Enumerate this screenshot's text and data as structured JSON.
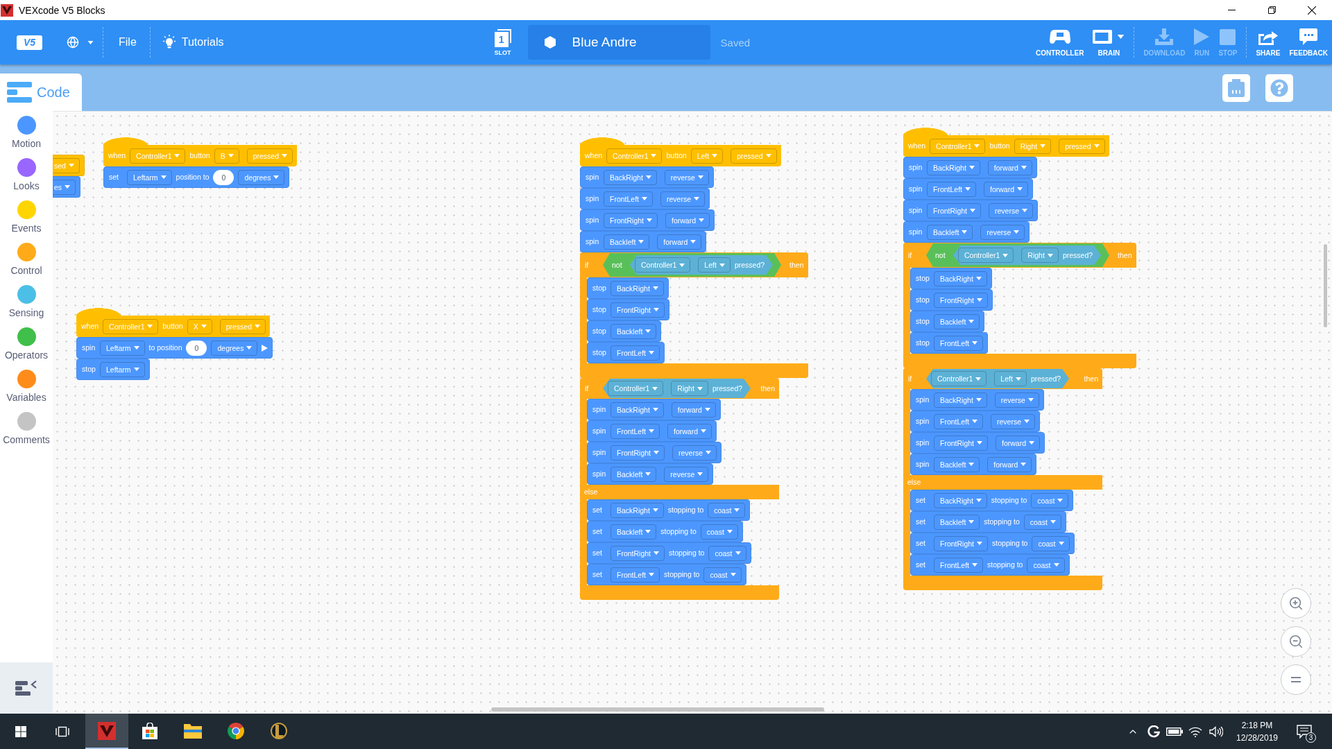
{
  "window": {
    "title": "VEXcode V5 Blocks"
  },
  "toolbar": {
    "logo": "V5",
    "file_menu": "File",
    "tutorials": "Tutorials",
    "slot": {
      "number": "1",
      "label": "SLOT"
    },
    "project_name": "Blue Andre",
    "save_status": "Saved",
    "actions": [
      {
        "kind": "controller",
        "label": "CONTROLLER",
        "disabled": false
      },
      {
        "kind": "brain",
        "label": "BRAIN",
        "disabled": false
      },
      {
        "kind": "download",
        "label": "DOWNLOAD",
        "disabled": true
      },
      {
        "kind": "run",
        "label": "RUN",
        "disabled": true
      },
      {
        "kind": "stop",
        "label": "STOP",
        "disabled": true
      },
      {
        "kind": "share",
        "label": "SHARE",
        "disabled": false
      },
      {
        "kind": "feedback",
        "label": "FEEDBACK",
        "disabled": false
      }
    ]
  },
  "tabs": [
    {
      "label": "Code",
      "selected": true
    }
  ],
  "categories": [
    {
      "label": "Motion",
      "color": "#4c97ff"
    },
    {
      "label": "Looks",
      "color": "#9966ff"
    },
    {
      "label": "Events",
      "color": "#ffd500"
    },
    {
      "label": "Control",
      "color": "#ffab19"
    },
    {
      "label": "Sensing",
      "color": "#4cbfe6"
    },
    {
      "label": "Operators",
      "color": "#40bf4a"
    },
    {
      "label": "Variables",
      "color": "#ff8c1a"
    },
    {
      "label": "Comments",
      "color": "#c4c4c4"
    }
  ],
  "workspace": {
    "scripts": [
      {
        "blocks": [
          {
            "kind": "stack",
            "color": "#ffbf00",
            "parts": [
              {
                "kind": "dropdown",
                "text": "sed"
              }
            ]
          },
          {
            "kind": "stack",
            "color": "#4c97ff",
            "parts": [
              {
                "kind": "dropdown",
                "text": "es"
              }
            ]
          }
        ]
      },
      {
        "blocks": [
          {
            "kind": "hat",
            "color": "#ffbf00",
            "parts": [
              {
                "kind": "label",
                "text": "when"
              },
              {
                "kind": "dropdown",
                "text": "Controller1"
              },
              {
                "kind": "label",
                "text": "button"
              },
              {
                "kind": "dropdown",
                "text": "B"
              },
              {
                "kind": "dropdown",
                "text": "pressed"
              }
            ]
          },
          {
            "kind": "stack",
            "color": "#4c97ff",
            "parts": [
              {
                "kind": "label",
                "text": "set"
              },
              {
                "kind": "dropdown",
                "text": "Leftarm"
              },
              {
                "kind": "label",
                "text": "position to"
              },
              {
                "kind": "number",
                "text": "0"
              },
              {
                "kind": "dropdown",
                "text": "degrees"
              }
            ]
          }
        ]
      },
      {
        "blocks": [
          {
            "kind": "hat",
            "color": "#ffbf00",
            "parts": [
              {
                "kind": "label",
                "text": "when"
              },
              {
                "kind": "dropdown",
                "text": "Controller1"
              },
              {
                "kind": "label",
                "text": "button"
              },
              {
                "kind": "dropdown",
                "text": "X"
              },
              {
                "kind": "dropdown",
                "text": "pressed"
              }
            ]
          },
          {
            "kind": "stack",
            "color": "#4c97ff",
            "parts": [
              {
                "kind": "label",
                "text": "spin"
              },
              {
                "kind": "dropdown",
                "text": "Leftarm"
              },
              {
                "kind": "label",
                "text": "to position"
              },
              {
                "kind": "number",
                "text": "0"
              },
              {
                "kind": "dropdown",
                "text": "degrees"
              },
              {
                "kind": "expander"
              }
            ]
          },
          {
            "kind": "stack",
            "color": "#4c97ff",
            "parts": [
              {
                "kind": "label",
                "text": "stop"
              },
              {
                "kind": "dropdown",
                "text": "Leftarm"
              }
            ]
          }
        ]
      },
      {
        "blocks": [
          {
            "kind": "hat",
            "color": "#ffbf00",
            "parts": [
              {
                "kind": "label",
                "text": "when"
              },
              {
                "kind": "dropdown",
                "text": "Controller1"
              },
              {
                "kind": "label",
                "text": "button"
              },
              {
                "kind": "dropdown",
                "text": "Left"
              },
              {
                "kind": "dropdown",
                "text": "pressed"
              }
            ]
          },
          {
            "kind": "stack",
            "color": "#4c97ff",
            "parts": [
              {
                "kind": "label",
                "text": "spin"
              },
              {
                "kind": "dropdown",
                "text": "BackRight"
              },
              {
                "kind": "dropdown",
                "text": "reverse"
              }
            ]
          },
          {
            "kind": "stack",
            "color": "#4c97ff",
            "parts": [
              {
                "kind": "label",
                "text": "spin"
              },
              {
                "kind": "dropdown",
                "text": "FrontLeft"
              },
              {
                "kind": "dropdown",
                "text": "reverse"
              }
            ]
          },
          {
            "kind": "stack",
            "color": "#4c97ff",
            "parts": [
              {
                "kind": "label",
                "text": "spin"
              },
              {
                "kind": "dropdown",
                "text": "FrontRight"
              },
              {
                "kind": "dropdown",
                "text": "forward"
              }
            ]
          },
          {
            "kind": "stack",
            "color": "#4c97ff",
            "parts": [
              {
                "kind": "label",
                "text": "spin"
              },
              {
                "kind": "dropdown",
                "text": "Backleft"
              },
              {
                "kind": "dropdown",
                "text": "forward"
              }
            ]
          },
          {
            "kind": "if",
            "color": "#ffab19",
            "parts": [
              {
                "kind": "label",
                "text": "if"
              },
              {
                "kind": "boolean",
                "color": "#59c059",
                "parts": [
                  {
                    "kind": "label",
                    "text": "not"
                  },
                  {
                    "kind": "boolean",
                    "color": "#5cb1d6",
                    "parts": [
                      {
                        "kind": "dropdown",
                        "text": "Controller1"
                      },
                      {
                        "kind": "dropdown",
                        "text": "Left"
                      },
                      {
                        "kind": "label",
                        "text": "pressed?"
                      }
                    ]
                  }
                ]
              },
              {
                "kind": "label",
                "text": "then"
              }
            ],
            "body": [
              {
                "kind": "stack",
                "color": "#4c97ff",
                "parts": [
                  {
                    "kind": "label",
                    "text": "stop"
                  },
                  {
                    "kind": "dropdown",
                    "text": "BackRight"
                  }
                ]
              },
              {
                "kind": "stack",
                "color": "#4c97ff",
                "parts": [
                  {
                    "kind": "label",
                    "text": "stop"
                  },
                  {
                    "kind": "dropdown",
                    "text": "FrontRight"
                  }
                ]
              },
              {
                "kind": "stack",
                "color": "#4c97ff",
                "parts": [
                  {
                    "kind": "label",
                    "text": "stop"
                  },
                  {
                    "kind": "dropdown",
                    "text": "Backleft"
                  }
                ]
              },
              {
                "kind": "stack",
                "color": "#4c97ff",
                "parts": [
                  {
                    "kind": "label",
                    "text": "stop"
                  },
                  {
                    "kind": "dropdown",
                    "text": "FrontLeft"
                  }
                ]
              }
            ]
          },
          {
            "kind": "if_else",
            "color": "#ffab19",
            "parts": [
              {
                "kind": "label",
                "text": "if"
              },
              {
                "kind": "boolean",
                "color": "#5cb1d6",
                "parts": [
                  {
                    "kind": "dropdown",
                    "text": "Controller1"
                  },
                  {
                    "kind": "dropdown",
                    "text": "Right"
                  },
                  {
                    "kind": "label",
                    "text": "pressed?"
                  }
                ]
              },
              {
                "kind": "label",
                "text": "then"
              }
            ],
            "body": [
              {
                "kind": "stack",
                "color": "#4c97ff",
                "parts": [
                  {
                    "kind": "label",
                    "text": "spin"
                  },
                  {
                    "kind": "dropdown",
                    "text": "BackRight"
                  },
                  {
                    "kind": "dropdown",
                    "text": "forward"
                  }
                ]
              },
              {
                "kind": "stack",
                "color": "#4c97ff",
                "parts": [
                  {
                    "kind": "label",
                    "text": "spin"
                  },
                  {
                    "kind": "dropdown",
                    "text": "FrontLeft"
                  },
                  {
                    "kind": "dropdown",
                    "text": "forward"
                  }
                ]
              },
              {
                "kind": "stack",
                "color": "#4c97ff",
                "parts": [
                  {
                    "kind": "label",
                    "text": "spin"
                  },
                  {
                    "kind": "dropdown",
                    "text": "FrontRight"
                  },
                  {
                    "kind": "dropdown",
                    "text": "reverse"
                  }
                ]
              },
              {
                "kind": "stack",
                "color": "#4c97ff",
                "parts": [
                  {
                    "kind": "label",
                    "text": "spin"
                  },
                  {
                    "kind": "dropdown",
                    "text": "Backleft"
                  },
                  {
                    "kind": "dropdown",
                    "text": "reverse"
                  }
                ]
              }
            ],
            "else_label": "else",
            "else_body": [
              {
                "kind": "stack",
                "color": "#4c97ff",
                "parts": [
                  {
                    "kind": "label",
                    "text": "set"
                  },
                  {
                    "kind": "dropdown",
                    "text": "BackRight"
                  },
                  {
                    "kind": "label",
                    "text": "stopping to"
                  },
                  {
                    "kind": "dropdown",
                    "text": "coast"
                  }
                ]
              },
              {
                "kind": "stack",
                "color": "#4c97ff",
                "parts": [
                  {
                    "kind": "label",
                    "text": "set"
                  },
                  {
                    "kind": "dropdown",
                    "text": "Backleft"
                  },
                  {
                    "kind": "label",
                    "text": "stopping to"
                  },
                  {
                    "kind": "dropdown",
                    "text": "coast"
                  }
                ]
              },
              {
                "kind": "stack",
                "color": "#4c97ff",
                "parts": [
                  {
                    "kind": "label",
                    "text": "set"
                  },
                  {
                    "kind": "dropdown",
                    "text": "FrontRight"
                  },
                  {
                    "kind": "label",
                    "text": "stopping to"
                  },
                  {
                    "kind": "dropdown",
                    "text": "coast"
                  }
                ]
              },
              {
                "kind": "stack",
                "color": "#4c97ff",
                "parts": [
                  {
                    "kind": "label",
                    "text": "set"
                  },
                  {
                    "kind": "dropdown",
                    "text": "FrontLeft"
                  },
                  {
                    "kind": "label",
                    "text": "stopping to"
                  },
                  {
                    "kind": "dropdown",
                    "text": "coast"
                  }
                ]
              }
            ]
          }
        ]
      },
      {
        "blocks": [
          {
            "kind": "hat",
            "color": "#ffbf00",
            "parts": [
              {
                "kind": "label",
                "text": "when"
              },
              {
                "kind": "dropdown",
                "text": "Controller1"
              },
              {
                "kind": "label",
                "text": "button"
              },
              {
                "kind": "dropdown",
                "text": "Right"
              },
              {
                "kind": "dropdown",
                "text": "pressed"
              }
            ]
          },
          {
            "kind": "stack",
            "color": "#4c97ff",
            "parts": [
              {
                "kind": "label",
                "text": "spin"
              },
              {
                "kind": "dropdown",
                "text": "BackRight"
              },
              {
                "kind": "dropdown",
                "text": "forward"
              }
            ]
          },
          {
            "kind": "stack",
            "color": "#4c97ff",
            "parts": [
              {
                "kind": "label",
                "text": "spin"
              },
              {
                "kind": "dropdown",
                "text": "FrontLeft"
              },
              {
                "kind": "dropdown",
                "text": "forward"
              }
            ]
          },
          {
            "kind": "stack",
            "color": "#4c97ff",
            "parts": [
              {
                "kind": "label",
                "text": "spin"
              },
              {
                "kind": "dropdown",
                "text": "FrontRight"
              },
              {
                "kind": "dropdown",
                "text": "reverse"
              }
            ]
          },
          {
            "kind": "stack",
            "color": "#4c97ff",
            "parts": [
              {
                "kind": "label",
                "text": "spin"
              },
              {
                "kind": "dropdown",
                "text": "Backleft"
              },
              {
                "kind": "dropdown",
                "text": "reverse"
              }
            ]
          },
          {
            "kind": "if",
            "color": "#ffab19",
            "parts": [
              {
                "kind": "label",
                "text": "if"
              },
              {
                "kind": "boolean",
                "color": "#59c059",
                "parts": [
                  {
                    "kind": "label",
                    "text": "not"
                  },
                  {
                    "kind": "boolean",
                    "color": "#5cb1d6",
                    "parts": [
                      {
                        "kind": "dropdown",
                        "text": "Controller1"
                      },
                      {
                        "kind": "dropdown",
                        "text": "Right"
                      },
                      {
                        "kind": "label",
                        "text": "pressed?"
                      }
                    ]
                  }
                ]
              },
              {
                "kind": "label",
                "text": "then"
              }
            ],
            "body": [
              {
                "kind": "stack",
                "color": "#4c97ff",
                "parts": [
                  {
                    "kind": "label",
                    "text": "stop"
                  },
                  {
                    "kind": "dropdown",
                    "text": "BackRight"
                  }
                ]
              },
              {
                "kind": "stack",
                "color": "#4c97ff",
                "parts": [
                  {
                    "kind": "label",
                    "text": "stop"
                  },
                  {
                    "kind": "dropdown",
                    "text": "FrontRight"
                  }
                ]
              },
              {
                "kind": "stack",
                "color": "#4c97ff",
                "parts": [
                  {
                    "kind": "label",
                    "text": "stop"
                  },
                  {
                    "kind": "dropdown",
                    "text": "Backleft"
                  }
                ]
              },
              {
                "kind": "stack",
                "color": "#4c97ff",
                "parts": [
                  {
                    "kind": "label",
                    "text": "stop"
                  },
                  {
                    "kind": "dropdown",
                    "text": "FrontLeft"
                  }
                ]
              }
            ]
          },
          {
            "kind": "if_else",
            "color": "#ffab19",
            "parts": [
              {
                "kind": "label",
                "text": "if"
              },
              {
                "kind": "boolean",
                "color": "#5cb1d6",
                "parts": [
                  {
                    "kind": "dropdown",
                    "text": "Controller1"
                  },
                  {
                    "kind": "dropdown",
                    "text": "Left"
                  },
                  {
                    "kind": "label",
                    "text": "pressed?"
                  }
                ]
              },
              {
                "kind": "label",
                "text": "then"
              }
            ],
            "body": [
              {
                "kind": "stack",
                "color": "#4c97ff",
                "parts": [
                  {
                    "kind": "label",
                    "text": "spin"
                  },
                  {
                    "kind": "dropdown",
                    "text": "BackRight"
                  },
                  {
                    "kind": "dropdown",
                    "text": "reverse"
                  }
                ]
              },
              {
                "kind": "stack",
                "color": "#4c97ff",
                "parts": [
                  {
                    "kind": "label",
                    "text": "spin"
                  },
                  {
                    "kind": "dropdown",
                    "text": "FrontLeft"
                  },
                  {
                    "kind": "dropdown",
                    "text": "reverse"
                  }
                ]
              },
              {
                "kind": "stack",
                "color": "#4c97ff",
                "parts": [
                  {
                    "kind": "label",
                    "text": "spin"
                  },
                  {
                    "kind": "dropdown",
                    "text": "FrontRight"
                  },
                  {
                    "kind": "dropdown",
                    "text": "forward"
                  }
                ]
              },
              {
                "kind": "stack",
                "color": "#4c97ff",
                "parts": [
                  {
                    "kind": "label",
                    "text": "spin"
                  },
                  {
                    "kind": "dropdown",
                    "text": "Backleft"
                  },
                  {
                    "kind": "dropdown",
                    "text": "forward"
                  }
                ]
              }
            ],
            "else_label": "else",
            "else_body": [
              {
                "kind": "stack",
                "color": "#4c97ff",
                "parts": [
                  {
                    "kind": "label",
                    "text": "set"
                  },
                  {
                    "kind": "dropdown",
                    "text": "BackRight"
                  },
                  {
                    "kind": "label",
                    "text": "stopping to"
                  },
                  {
                    "kind": "dropdown",
                    "text": "coast"
                  }
                ]
              },
              {
                "kind": "stack",
                "color": "#4c97ff",
                "parts": [
                  {
                    "kind": "label",
                    "text": "set"
                  },
                  {
                    "kind": "dropdown",
                    "text": "Backleft"
                  },
                  {
                    "kind": "label",
                    "text": "stopping to"
                  },
                  {
                    "kind": "dropdown",
                    "text": "coast"
                  }
                ]
              },
              {
                "kind": "stack",
                "color": "#4c97ff",
                "parts": [
                  {
                    "kind": "label",
                    "text": "set"
                  },
                  {
                    "kind": "dropdown",
                    "text": "FrontRight"
                  },
                  {
                    "kind": "label",
                    "text": "stopping to"
                  },
                  {
                    "kind": "dropdown",
                    "text": "coast"
                  }
                ]
              },
              {
                "kind": "stack",
                "color": "#4c97ff",
                "parts": [
                  {
                    "kind": "label",
                    "text": "set"
                  },
                  {
                    "kind": "dropdown",
                    "text": "FrontLeft"
                  },
                  {
                    "kind": "label",
                    "text": "stopping to"
                  },
                  {
                    "kind": "dropdown",
                    "text": "coast"
                  }
                ]
              }
            ]
          }
        ]
      }
    ]
  },
  "taskbar": {
    "apps": [
      {
        "kind": "vexcode",
        "selected": true
      },
      {
        "kind": "store",
        "selected": false
      },
      {
        "kind": "explorer",
        "selected": false
      },
      {
        "kind": "browser",
        "selected": false
      },
      {
        "kind": "game",
        "selected": false
      }
    ],
    "time": "2:18 PM",
    "date": "12/28/2019",
    "notification_count": "3"
  }
}
